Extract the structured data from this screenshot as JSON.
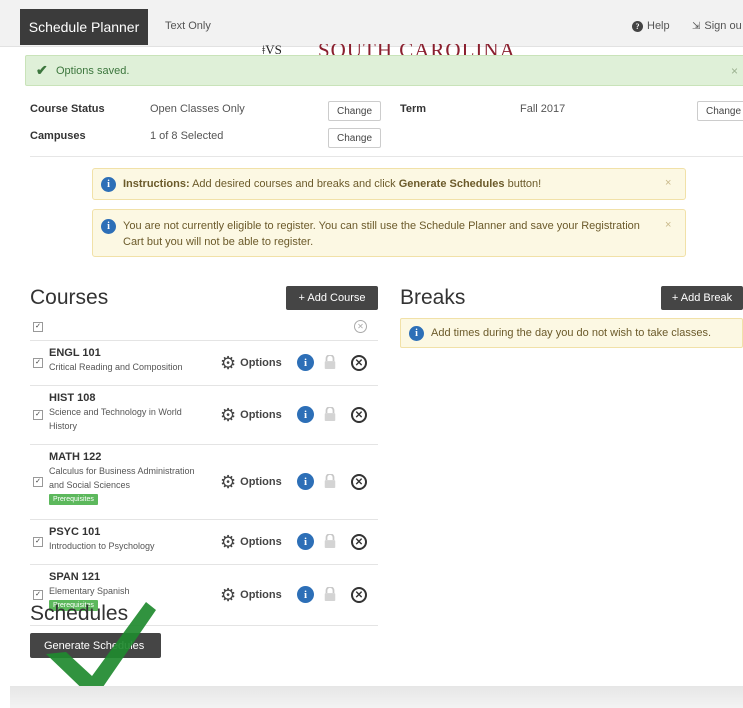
{
  "topbar": {
    "brand": "Schedule Planner",
    "text_only": "Text Only",
    "help": "Help",
    "sign_out": "Sign ou",
    "logo_text": "SOUTH CAROLINA",
    "logo_mark": "ǂVS"
  },
  "alert": {
    "message": "Options saved.",
    "close": "×"
  },
  "settings": {
    "course_status_label": "Course Status",
    "course_status_value": "Open Classes Only",
    "campuses_label": "Campuses",
    "campuses_value": "1 of 8 Selected",
    "term_label": "Term",
    "term_value": "Fall 2017",
    "change_label": "Change"
  },
  "instructions": {
    "prefix": "Instructions:",
    "text_before": " Add desired courses and breaks and click ",
    "bold": "Generate Schedules",
    "text_after": " button!",
    "close": "×"
  },
  "eligibility": {
    "line1": "You are not currently eligible to register. You can still use the Schedule Planner and save your Registration",
    "line2": "Cart but you will not be able to register.",
    "close": "×"
  },
  "courses": {
    "heading": "Courses",
    "add_button": "+ Add Course",
    "options_label": "Options",
    "items": [
      {
        "code": "ENGL 101",
        "title_lines": [
          "Critical Reading and Composition"
        ],
        "prereq": ""
      },
      {
        "code": "HIST 108",
        "title_lines": [
          "Science and Technology in World",
          "History"
        ],
        "prereq": ""
      },
      {
        "code": "MATH 122",
        "title_lines": [
          "Calculus for Business Administration",
          "and Social Sciences"
        ],
        "prereq": "Prerequisites"
      },
      {
        "code": "PSYC 101",
        "title_lines": [
          "Introduction to Psychology"
        ],
        "prereq": ""
      },
      {
        "code": "SPAN 121",
        "title_lines": [
          "Elementary Spanish"
        ],
        "prereq": "Prerequisites"
      }
    ]
  },
  "breaks": {
    "heading": "Breaks",
    "add_button": "+ Add Break",
    "info": "Add times during the day you do not wish to take classes."
  },
  "schedules": {
    "heading": "Schedules",
    "generate_button": "Generate Schedules"
  },
  "colors": {
    "success_green": "#3c763d",
    "info_blue": "#2d6fb7",
    "prereq_green": "#5cb85c",
    "checkmark_overlay": "#1f8a2f"
  }
}
